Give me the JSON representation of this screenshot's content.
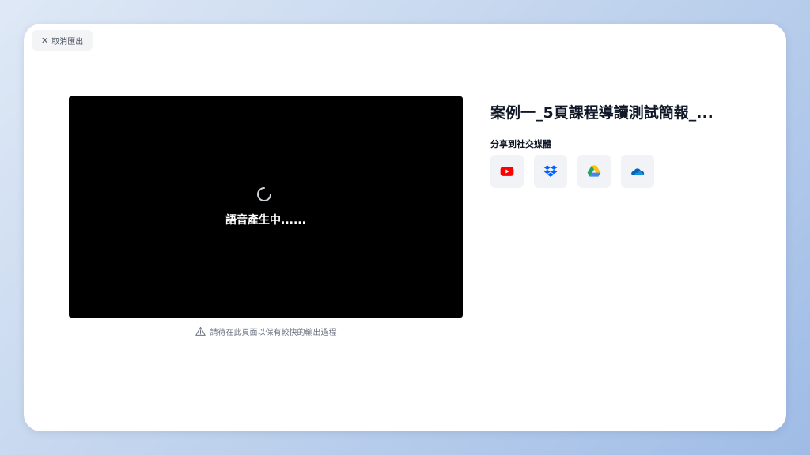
{
  "cancel_button": {
    "icon": "close-icon",
    "label": "取消匯出"
  },
  "video_panel": {
    "status": "語音產生中......",
    "spinner_icon": "loading-spinner-icon"
  },
  "notice": {
    "icon": "warning-icon",
    "text": "請待在此頁面以保有較快的輸出過程"
  },
  "project": {
    "title": "案例一_5頁課程導讀測試簡報_..."
  },
  "share": {
    "label": "分享到社交媒體",
    "services": [
      {
        "icon": "youtube-icon",
        "color": "#FF0000"
      },
      {
        "icon": "dropbox-icon",
        "color": "#0061FF"
      },
      {
        "icon": "google-drive-icon",
        "color": "#1FA463"
      },
      {
        "icon": "onedrive-icon",
        "color": "#0364B8"
      }
    ]
  }
}
